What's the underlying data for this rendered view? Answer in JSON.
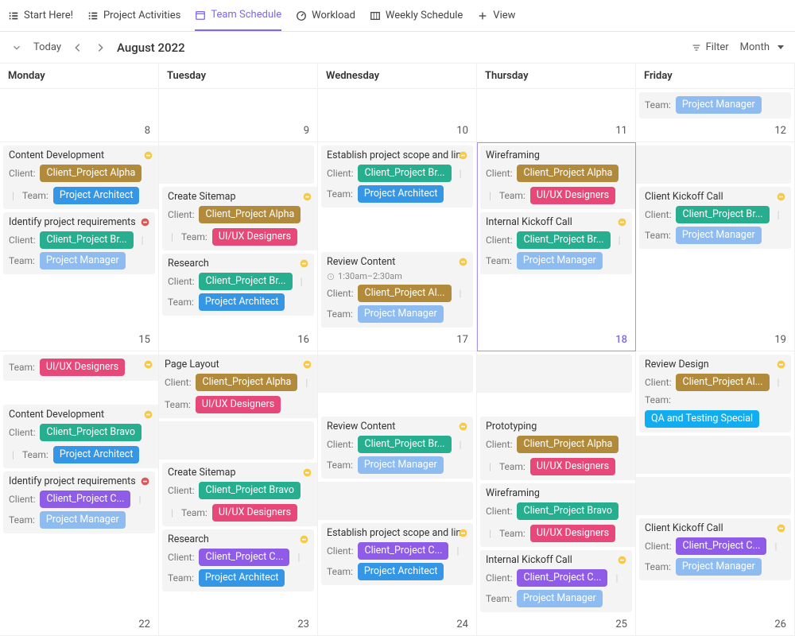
{
  "tabs": [
    {
      "label": "Start Here!",
      "icon": "list"
    },
    {
      "label": "Project Activities",
      "icon": "list"
    },
    {
      "label": "Team Schedule",
      "icon": "calendar",
      "active": true
    },
    {
      "label": "Workload",
      "icon": "gauge"
    },
    {
      "label": "Weekly Schedule",
      "icon": "board"
    },
    {
      "label": "View",
      "icon": "plus"
    }
  ],
  "toolbar": {
    "today": "Today",
    "title": "August 2022",
    "filter": "Filter",
    "viewmode": "Month"
  },
  "labels": {
    "client": "Client:",
    "team": "Team:"
  },
  "day_headers": [
    "Monday",
    "Tuesday",
    "Wednesday",
    "Thursday",
    "Friday"
  ],
  "colors": {
    "alpha": "#b28a3b",
    "bravo": "#27ae8e",
    "charlie": "#8e5ce6",
    "pm": "#8fbcf0",
    "pa": "#3596e6",
    "ux": "#e6487a",
    "qa": "#12acf0"
  },
  "status": {
    "open": "#f7c948",
    "blocked": "#e05555"
  },
  "weeks": [
    {
      "dates": [
        "8",
        "9",
        "10",
        "11",
        "12"
      ],
      "cells": [
        [],
        [],
        [],
        [],
        [
          {
            "title_only": true,
            "team_label": "Team:",
            "team": "pm",
            "team_text": "Project Manager",
            "overflow": true
          }
        ]
      ]
    },
    {
      "dates": [
        "15",
        "16",
        "17",
        "18",
        "19"
      ],
      "today_index": 3,
      "cells": [
        [
          {
            "title": "Content Development",
            "client": "alpha",
            "client_text": "Client_Project Alpha",
            "team": "pa",
            "team_text": "Project Architect",
            "span": "right",
            "status": "open",
            "show_all": true
          },
          {
            "title": "Identify project requirements",
            "client": "bravo",
            "client_text": "Client_Project Br...",
            "team": "pm",
            "team_text": "Project Manager",
            "status": "blocked"
          }
        ],
        [
          {
            "continuation": true
          },
          {
            "title": "Create Sitemap",
            "client": "alpha",
            "client_text": "Client_Project Alpha",
            "team": "ux",
            "team_text": "UI/UX Designers",
            "span": "right",
            "status": "open",
            "show_all": true
          },
          {
            "title": "Research",
            "client": "bravo",
            "client_text": "Client_Project Br...",
            "team": "pa",
            "team_text": "Project Architect",
            "status": "open"
          }
        ],
        [
          {
            "title": "Establish project scope and lin",
            "client": "bravo",
            "client_text": "Client_Project Br...",
            "team": "pa",
            "team_text": "Project Architect",
            "status": "open"
          },
          {
            "gap": true
          },
          {
            "gap": true
          },
          {
            "title": "Review Content",
            "time": "1:30am–2:30am",
            "client": "alpha",
            "client_text": "Client_Project Al...",
            "team": "pm",
            "team_text": "Project Manager",
            "status": "open"
          }
        ],
        [
          {
            "title": "Wireframing",
            "client": "alpha",
            "client_text": "Client_Project Alpha",
            "team": "ux",
            "team_text": "UI/UX Designers",
            "span": "right",
            "show_all": true
          },
          {
            "title": "Internal Kickoff Call",
            "client": "bravo",
            "client_text": "Client_Project Br...",
            "team": "pm",
            "team_text": "Project Manager",
            "status": "open"
          }
        ],
        [
          {
            "continuation": true
          },
          {
            "title": "Client Kickoff Call",
            "client": "bravo",
            "client_text": "Client_Project Br...",
            "team": "pm",
            "team_text": "Project Manager",
            "status": "open"
          }
        ]
      ]
    },
    {
      "dates": [
        "22",
        "23",
        "24",
        "25",
        "26"
      ],
      "cells": [
        [
          {
            "title_only": true,
            "team": "ux",
            "team_text": "UI/UX Designers",
            "status": "open",
            "team_label": "Team:",
            "overflow": true,
            "span": "right"
          },
          {
            "gap": true
          },
          {
            "title": "Content Development",
            "client": "bravo",
            "client_text": "Client_Project Bravo",
            "team": "pa",
            "team_text": "Project Architect",
            "span": "right",
            "status": "open",
            "show_all": true
          },
          {
            "title": "Identify project requirements",
            "client": "charlie",
            "client_text": "Client_Project C...",
            "team": "pm",
            "team_text": "Project Manager",
            "status": "blocked"
          }
        ],
        [
          {
            "title": "Page Layout",
            "client": "alpha",
            "client_text": "Client_Project Alpha",
            "team": "ux",
            "team_text": "UI/UX Designers",
            "span": "both",
            "status": "open",
            "show_all": true
          },
          {
            "continuation": true
          },
          {
            "title": "Create Sitemap",
            "client": "bravo",
            "client_text": "Client_Project Bravo",
            "team": "ux",
            "team_text": "UI/UX Designers",
            "span": "right",
            "status": "open",
            "show_all": true
          },
          {
            "title": "Research",
            "client": "charlie",
            "client_text": "Client_Project C...",
            "team": "pa",
            "team_text": "Project Architect",
            "status": "open"
          }
        ],
        [
          {
            "continuation": true
          },
          {
            "gap": true
          },
          {
            "title": "Review Content",
            "client": "bravo",
            "client_text": "Client_Project Br...",
            "team": "pm",
            "team_text": "Project Manager",
            "status": "open"
          },
          {
            "continuation": true
          },
          {
            "title": "Establish project scope and lin",
            "client": "charlie",
            "client_text": "Client_Project C...",
            "team": "pa",
            "team_text": "Project Architect",
            "status": "open"
          }
        ],
        [
          {
            "continuation": true
          },
          {
            "gap": true
          },
          {
            "title": "Prototyping",
            "client": "alpha",
            "client_text": "Client_Project Alpha",
            "team": "ux",
            "team_text": "UI/UX Designers",
            "span": "right",
            "show_all": true
          },
          {
            "title": "Wireframing",
            "client": "bravo",
            "client_text": "Client_Project Bravo",
            "team": "ux",
            "team_text": "UI/UX Designers",
            "span": "right",
            "show_all": true
          },
          {
            "title": "Internal Kickoff Call",
            "client": "charlie",
            "client_text": "Client_Project C...",
            "team": "pm",
            "team_text": "Project Manager",
            "status": "open"
          }
        ],
        [
          {
            "title": "Review Design",
            "client": "alpha",
            "client_text": "Client_Project Al...",
            "team": "qa",
            "team_text": "QA and Testing Special",
            "status": "open"
          },
          {
            "continuation": true
          },
          {
            "continuation": true
          },
          {
            "title": "Client Kickoff Call",
            "client": "charlie",
            "client_text": "Client_Project C...",
            "team": "pm",
            "team_text": "Project Manager",
            "status": "open"
          }
        ]
      ]
    }
  ]
}
